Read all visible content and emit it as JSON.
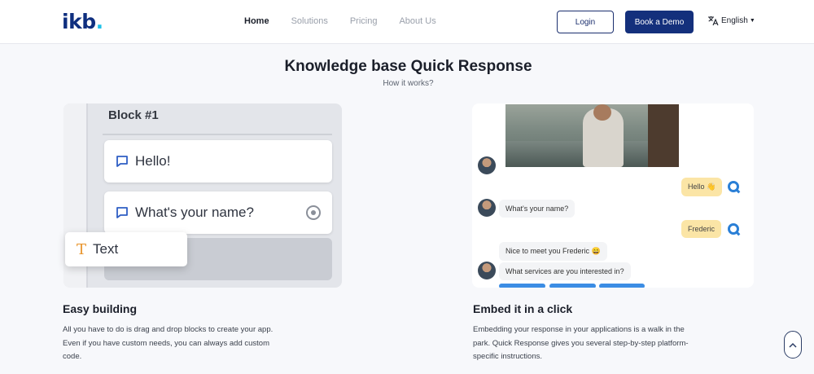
{
  "header": {
    "logo": "ikb",
    "logo_dot": ".",
    "nav": [
      "Home",
      "Solutions",
      "Pricing",
      "About Us"
    ],
    "login_label": "Login",
    "demo_label": "Book a Demo",
    "language": "English"
  },
  "hero": {
    "title": "Knowledge base Quick Response",
    "subtitle": "How it works?"
  },
  "builder": {
    "block_title": "Block #1",
    "message1": "Hello!",
    "message2": "What's your name?",
    "drag_label": "Text"
  },
  "chat": {
    "user_hello": "Hello 👋",
    "bot_ask_name": "What's your name?",
    "user_name": "Frederic",
    "bot_greet": "Nice to meet you Frederic 😄",
    "bot_services": "What services are you interested in?"
  },
  "features": {
    "easy_title": "Easy building",
    "easy_body": "All you have to do is drag and drop blocks to create your app. Even if you have custom needs, you can always add custom code.",
    "embed_title": "Embed it in a click",
    "embed_body": "Embedding your response in your applications is a walk in the park. Quick Response gives you several step-by-step platform-specific instructions."
  },
  "colors": {
    "brand": "#14307c",
    "accent": "#1ec1e8",
    "user_bubble": "#fbe5a6",
    "chat_icon": "#2a7fd6"
  },
  "icons": [
    "translate-icon",
    "chat-bubble-icon",
    "text-type-icon",
    "chevron-up-icon",
    "quick-response-icon"
  ]
}
